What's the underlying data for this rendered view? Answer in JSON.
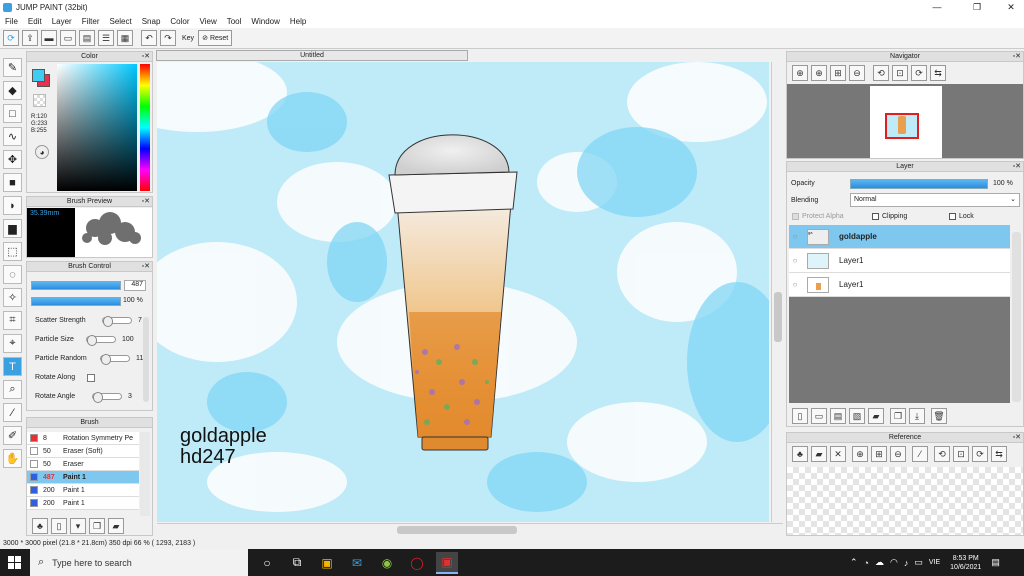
{
  "app": {
    "title": "JUMP PAINT (32bit)"
  },
  "menu": [
    "File",
    "Edit",
    "Layer",
    "Filter",
    "Select",
    "Snap",
    "Color",
    "View",
    "Tool",
    "Window",
    "Help"
  ],
  "toolbar": {
    "key_label": "Key",
    "reset_label": "Reset"
  },
  "document": {
    "tab": "Untitled"
  },
  "color_panel": {
    "title": "Color",
    "r": "R:120",
    "g": "G:233",
    "b": "B:255",
    "fg": "#40ccf0",
    "bg": "#e83050"
  },
  "brush_preview": {
    "title": "Brush Preview",
    "size": "35.39mm"
  },
  "brush_control": {
    "title": "Brush Control",
    "size_value": "487",
    "opacity_value": "100 %",
    "rows": [
      {
        "label": "Scatter Strength",
        "value": "7"
      },
      {
        "label": "Particle Size",
        "value": "100"
      },
      {
        "label": "Particle Random",
        "value": "11"
      },
      {
        "label": "Rotate Along",
        "value": ""
      },
      {
        "label": "Rotate Angle",
        "value": "3"
      }
    ]
  },
  "brush_list": {
    "title": "Brush",
    "items": [
      {
        "size": "8",
        "name": "Rotation Symmetry Pe",
        "color": "#e83030"
      },
      {
        "size": "50",
        "name": "Eraser (Soft)",
        "color": "#ffffff"
      },
      {
        "size": "50",
        "name": "Eraser",
        "color": "#ffffff"
      },
      {
        "size": "487",
        "name": "Paint 1",
        "color": "#3060e0",
        "selected": true
      },
      {
        "size": "200",
        "name": "Paint 1",
        "color": "#3060e0"
      },
      {
        "size": "200",
        "name": "Paint 1",
        "color": "#3060e0"
      }
    ]
  },
  "canvas": {
    "line1": "goldapple",
    "line2": "hd247"
  },
  "navigator": {
    "title": "Navigator"
  },
  "layer_panel": {
    "title": "Layer",
    "opacity_label": "Opacity",
    "opacity_value": "100 %",
    "blending_label": "Blending",
    "blending_value": "Normal",
    "protect_alpha": "Protect Alpha",
    "clipping": "Clipping",
    "lock": "Lock",
    "layers": [
      {
        "name": "goldapple",
        "selected": true
      },
      {
        "name": "Layer1"
      },
      {
        "name": "Layer1"
      }
    ]
  },
  "reference": {
    "title": "Reference"
  },
  "status": {
    "text": "3000 * 3000 pixel  (21.8 * 21.8cm)  350 dpi  66 %  ( 1293, 2183 )"
  },
  "taskbar": {
    "search": "Type here to search",
    "lang": "VIE",
    "time": "8:53 PM",
    "date": "10/6/2021"
  }
}
